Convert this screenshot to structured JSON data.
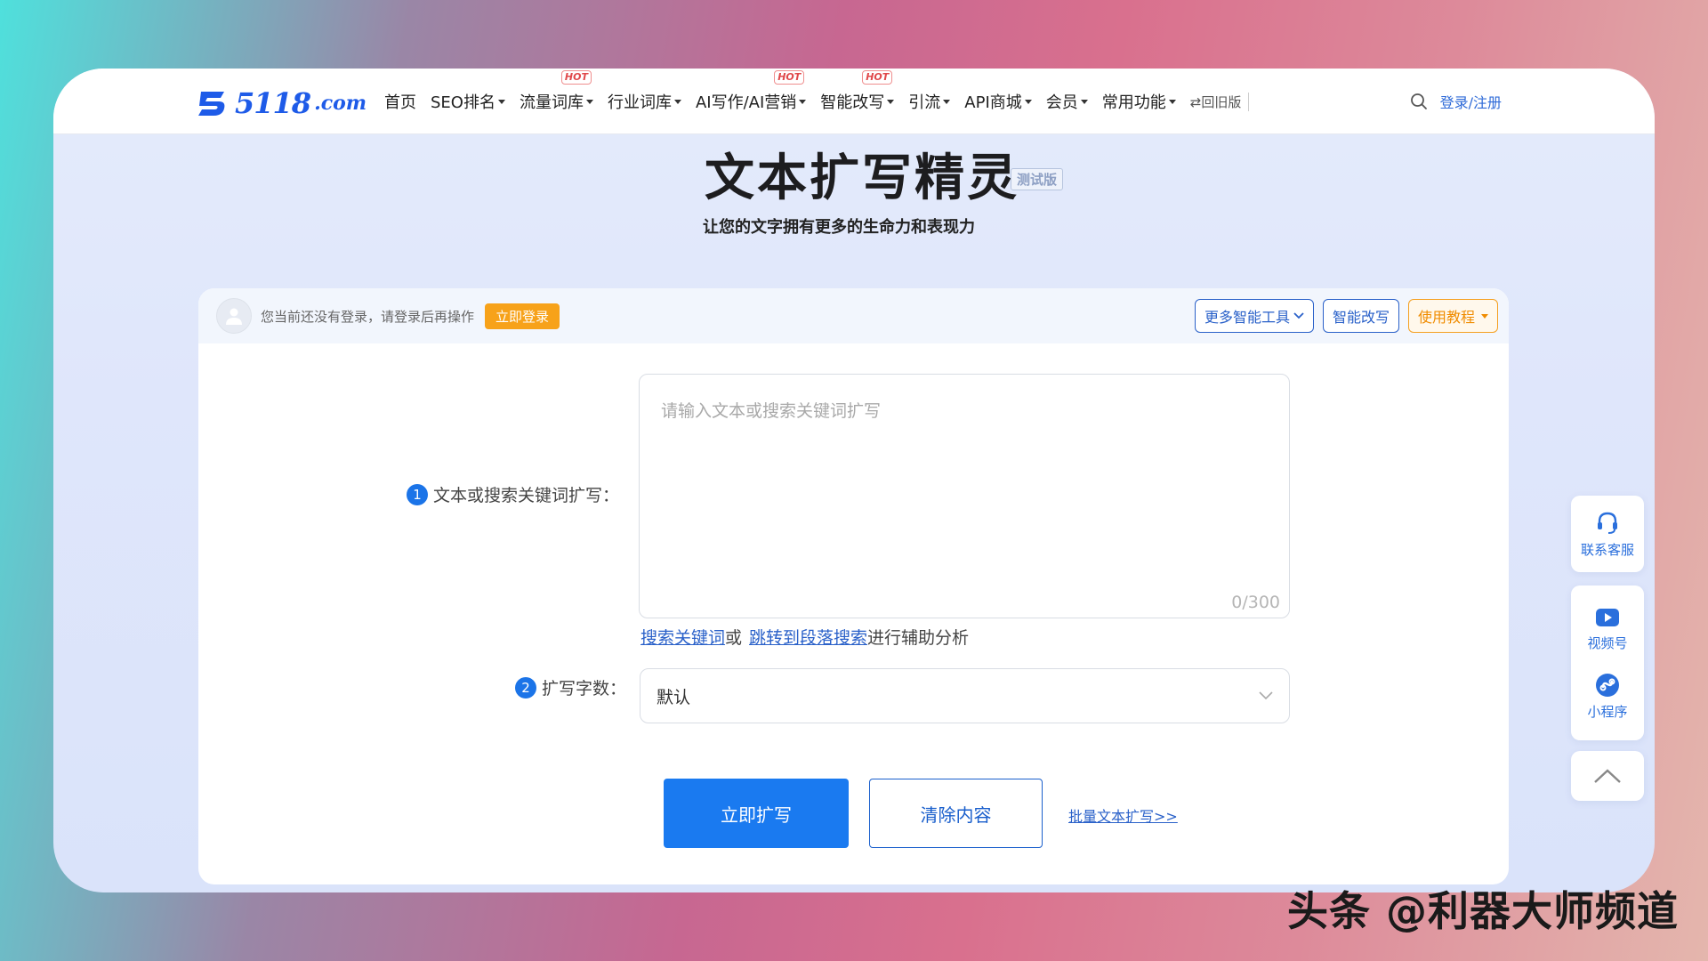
{
  "logo": {
    "text": "5118",
    "domain": ".com"
  },
  "nav": [
    {
      "label": "首页",
      "caret": false,
      "hot": false
    },
    {
      "label": "SEO排名",
      "caret": true,
      "hot": false
    },
    {
      "label": "流量词库",
      "caret": true,
      "hot": true
    },
    {
      "label": "行业词库",
      "caret": true,
      "hot": false
    },
    {
      "label": "AI写作/AI营销",
      "caret": true,
      "hot": true
    },
    {
      "label": "智能改写",
      "caret": true,
      "hot": true
    },
    {
      "label": "引流",
      "caret": true,
      "hot": false
    },
    {
      "label": "API商城",
      "caret": true,
      "hot": false
    },
    {
      "label": "会员",
      "caret": true,
      "hot": false
    },
    {
      "label": "常用功能",
      "caret": true,
      "hot": false
    }
  ],
  "hot_label": "HOT",
  "old_version": "⇄回旧版",
  "login_register": "登录/注册",
  "hero": {
    "title": "文本扩写精灵",
    "badge": "测试版",
    "subtitle": "让您的文字拥有更多的生命力和表现力"
  },
  "card": {
    "notice": "您当前还没有登录，请登录后再操作",
    "login_now": "立即登录",
    "more_tools": "更多智能工具",
    "smart_rewrite": "智能改写",
    "tutorial": "使用教程"
  },
  "form": {
    "step1_num": "1",
    "step1_label": "文本或搜索关键词扩写：",
    "textarea_placeholder": "请输入文本或搜索关键词扩写",
    "counter": "0/300",
    "helper_link1": "搜索关键词",
    "helper_or": "或",
    "helper_link2": "跳转到段落搜索",
    "helper_tail": "进行辅助分析",
    "step2_num": "2",
    "step2_label": "扩写字数：",
    "select_value": "默认",
    "submit": "立即扩写",
    "clear": "清除内容",
    "batch": "批量文本扩写>>"
  },
  "side": {
    "service": "联系客服",
    "video": "视频号",
    "miniprogram": "小程序"
  },
  "watermark": "头条 @利器大师频道",
  "colors": {
    "brand": "#1e5be8",
    "primary_button": "#1a7af0",
    "orange": "#f7a21a"
  }
}
